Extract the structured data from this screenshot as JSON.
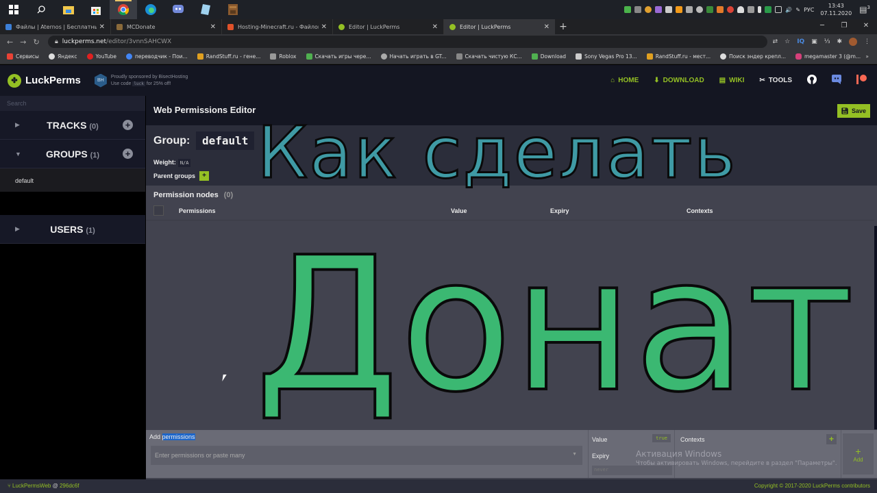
{
  "taskbar": {
    "icons": [
      "windows-start-icon",
      "search-icon",
      "file-explorer-icon",
      "store-icon",
      "chrome-icon",
      "edge-icon",
      "discord-icon",
      "notepad-icon",
      "minecraft-icon"
    ],
    "active_index": 4,
    "tray": {
      "language": "РУС",
      "time": "13:43",
      "date": "07.11.2020",
      "notifications": "3"
    }
  },
  "browser": {
    "tabs": [
      {
        "title": "Файлы | Aternos | Бесплатный с",
        "favicon_color": "#3c7fd6"
      },
      {
        "title": "MCDonate",
        "favicon_color": "#8a6a3a"
      },
      {
        "title": "Hosting-Minecraft.ru - Файловы",
        "favicon_color": "#e0522a"
      },
      {
        "title": "Editor | LuckPerms",
        "favicon_color": "#94c024"
      },
      {
        "title": "Editor | LuckPerms",
        "favicon_color": "#94c024",
        "active": true
      }
    ],
    "url_domain": "luckperms.net",
    "url_path": "/editor/3vnnSAHCWX",
    "bookmarks": [
      {
        "label": "Сервисы",
        "color": "#e94235"
      },
      {
        "label": "Яндекс",
        "color": "#ddd"
      },
      {
        "label": "YouTube",
        "color": "#e02020"
      },
      {
        "label": "переводчик - Пои...",
        "color": "#4285f4"
      },
      {
        "label": "RandStuff.ru - гене...",
        "color": "#e0a020"
      },
      {
        "label": "Roblox",
        "color": "#999"
      },
      {
        "label": "Скачать игры чере...",
        "color": "#50b050"
      },
      {
        "label": "Начать играть в GT...",
        "color": "#aaa"
      },
      {
        "label": "Скачать чистую КС...",
        "color": "#888"
      },
      {
        "label": "Download",
        "color": "#50b050"
      },
      {
        "label": "Sony Vegas Pro 13...",
        "color": "#ccc"
      },
      {
        "label": "RandStuff.ru - мест...",
        "color": "#e0a020"
      },
      {
        "label": "Поиск эндер крепл...",
        "color": "#ddd"
      },
      {
        "label": "megamaster 3 (@m...",
        "color": "#d6407a"
      }
    ]
  },
  "header": {
    "logo": "LuckPerms",
    "sponsor_line1": "Proudly sponsored by BisectHosting",
    "sponsor_line2_pre": "Use code",
    "sponsor_code": "luck",
    "sponsor_line2_post": "for 25% off!",
    "nav": [
      {
        "label": "HOME",
        "icon": "home-icon"
      },
      {
        "label": "DOWNLOAD",
        "icon": "download-icon"
      },
      {
        "label": "WIKI",
        "icon": "book-icon"
      },
      {
        "label": "TOOLS",
        "icon": "tools-icon"
      }
    ],
    "accent": "#94c024"
  },
  "sidebar": {
    "search_placeholder": "Search",
    "sections": [
      {
        "label": "TRACKS",
        "count": "(0)",
        "expanded": false
      },
      {
        "label": "GROUPS",
        "count": "(1)",
        "expanded": true,
        "items": [
          "default"
        ]
      },
      {
        "label": "USERS",
        "count": "(1)",
        "expanded": false
      }
    ]
  },
  "editor": {
    "title": "Web Permissions Editor",
    "save_label": "Save",
    "group_label": "Group:",
    "group_name": "default",
    "weight_label": "Weight:",
    "weight_value": "N/A",
    "parent_groups_label": "Parent groups",
    "permission_nodes_label": "Permission nodes",
    "permission_nodes_count": "(0)",
    "columns": [
      "Permissions",
      "Value",
      "Expiry",
      "Contexts"
    ]
  },
  "add_bar": {
    "label_pre": "Add",
    "label_sel": "permissions",
    "input_placeholder": "Enter permissions or paste many",
    "value_label": "Value",
    "value_toggle": "true",
    "expiry_label": "Expiry",
    "expiry_placeholder": "never",
    "contexts_label": "Contexts",
    "add_label": "Add"
  },
  "overlay": {
    "line1": "Как сделать",
    "line2": "Донат"
  },
  "windows_activation": {
    "title": "Активация Windows",
    "text": "Чтобы активировать Windows, перейдите в раздел \"Параметры\"."
  },
  "footer": {
    "project": "LuckPermsWeb",
    "at": "@",
    "commit": "296dc6f",
    "copyright": "Copyright © 2017-2020 LuckPerms contributors"
  }
}
